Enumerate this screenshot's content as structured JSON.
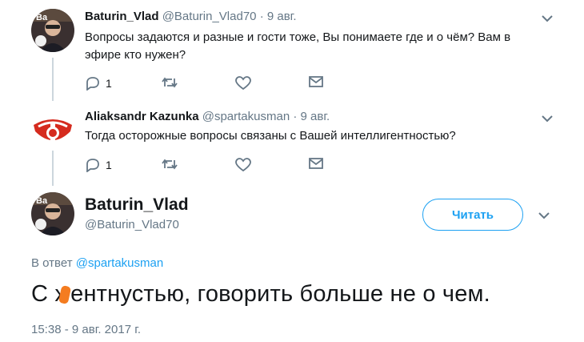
{
  "tweets": [
    {
      "name": "Baturin_Vlad",
      "handle": "@Baturin_Vlad70",
      "separator": "·",
      "date": "9 авг.",
      "text": "Вопросы задаются и разные и гости тоже, Вы понимаете где и о чём? Вам в эфире кто нужен?",
      "reply_count": "1"
    },
    {
      "name": "Aliaksandr Kazunka",
      "handle": "@spartakusman",
      "separator": "·",
      "date": "9 авг.",
      "text": "Тогда осторожные вопросы связаны с Вашей интеллигентностью?",
      "reply_count": "1"
    }
  ],
  "main": {
    "name": "Baturin_Vlad",
    "handle": "@Baturin_Vlad70",
    "follow_label": "Читать",
    "reply_prefix": "В ответ",
    "reply_handle": "@spartakusman",
    "text_before": "С х",
    "text_after": "ентнустью, говорить больше не о чем.",
    "timestamp": "15:38 - 9 авг. 2017 г."
  },
  "colors": {
    "accent": "#1da1f2",
    "secondary_text": "#657786",
    "thread_line": "#ccd6dd",
    "spartak_red": "#d52b1e",
    "redaction_orange": "#f47c20"
  },
  "icons": [
    "reply-icon",
    "retweet-icon",
    "like-icon",
    "dm-icon",
    "chevron-down-icon"
  ]
}
